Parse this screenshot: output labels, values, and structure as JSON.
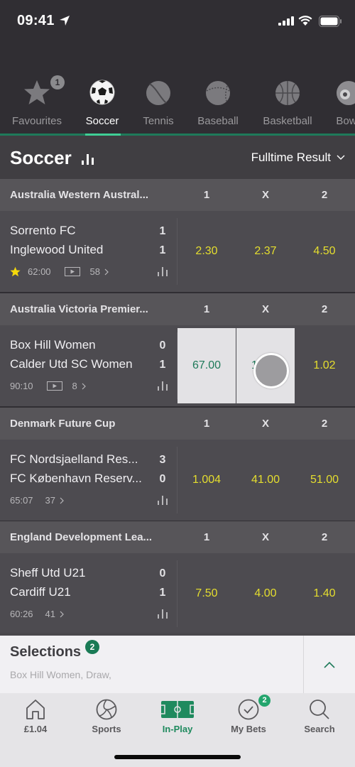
{
  "status_bar": {
    "time": "09:41"
  },
  "sports_tabs": [
    {
      "label": "Favourites",
      "icon": "star-icon",
      "badge": "1",
      "active": false
    },
    {
      "label": "Soccer",
      "icon": "soccer-ball-icon",
      "active": true
    },
    {
      "label": "Tennis",
      "icon": "tennis-ball-icon",
      "active": false
    },
    {
      "label": "Baseball",
      "icon": "baseball-icon",
      "active": false
    },
    {
      "label": "Basketball",
      "icon": "basketball-icon",
      "active": false
    },
    {
      "label": "Bow",
      "icon": "bowls-icon",
      "active": false
    }
  ],
  "section": {
    "title": "Soccer",
    "market": "Fulltime Result"
  },
  "columns": [
    "1",
    "X",
    "2"
  ],
  "competitions": [
    {
      "name": "Australia Western Austral...",
      "events": [
        {
          "home": "Sorrento FC",
          "away": "Inglewood United",
          "home_score": "1",
          "away_score": "1",
          "time": "62:00",
          "favourite": true,
          "stream": true,
          "markets": "58",
          "odds": [
            "2.30",
            "2.37",
            "4.50"
          ],
          "selected": []
        }
      ]
    },
    {
      "name": "Australia Victoria Premier...",
      "events": [
        {
          "home": "Box Hill Women",
          "away": "Calder Utd SC Women",
          "home_score": "0",
          "away_score": "1",
          "time": "90:10",
          "favourite": false,
          "stream": true,
          "markets": "8",
          "odds": [
            "67.00",
            "19.00",
            "1.02"
          ],
          "selected": [
            0,
            1
          ]
        }
      ]
    },
    {
      "name": "Denmark Future Cup",
      "events": [
        {
          "home": "FC Nordsjaelland Res...",
          "away": "FC København Reserv...",
          "home_score": "3",
          "away_score": "0",
          "time": "65:07",
          "favourite": false,
          "stream": false,
          "markets": "37",
          "odds": [
            "1.004",
            "41.00",
            "51.00"
          ],
          "selected": []
        }
      ]
    },
    {
      "name": "England Development Lea...",
      "events": [
        {
          "home": "Sheff Utd U21",
          "away": "Cardiff U21",
          "home_score": "0",
          "away_score": "1",
          "time": "60:26",
          "favourite": false,
          "stream": false,
          "markets": "41",
          "odds": [
            "7.50",
            "4.00",
            "1.40"
          ],
          "selected": []
        }
      ]
    }
  ],
  "selections": {
    "title": "Selections",
    "count": "2",
    "summary": "Box Hill Women,  Draw,"
  },
  "bottom_nav": [
    {
      "label": "£1.04",
      "icon": "home-icon",
      "active": false
    },
    {
      "label": "Sports",
      "icon": "sports-ball-icon",
      "active": false
    },
    {
      "label": "In-Play",
      "icon": "pitch-icon",
      "active": true
    },
    {
      "label": "My Bets",
      "icon": "check-circle-icon",
      "badge": "2",
      "active": false
    },
    {
      "label": "Search",
      "icon": "search-icon",
      "active": false
    }
  ],
  "colors": {
    "accent_green": "#1f8a5e",
    "odds_yellow": "#e5de2e",
    "tab_underline": "#3fcf95"
  }
}
